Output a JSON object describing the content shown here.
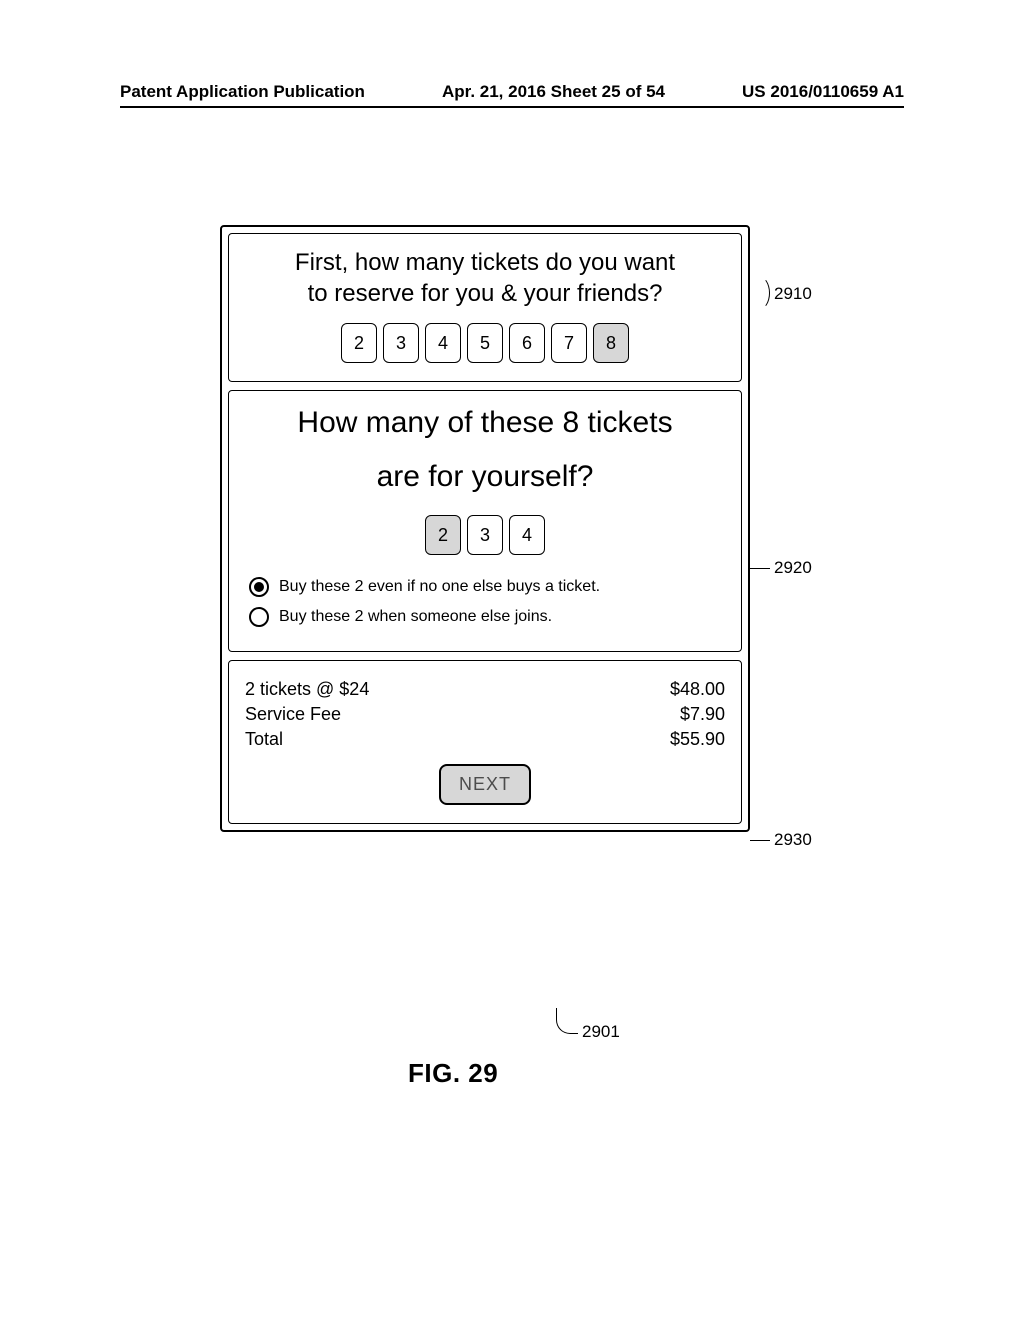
{
  "header": {
    "left": "Patent Application Publication",
    "middle": "Apr. 21, 2016  Sheet 25 of 54",
    "right": "US 2016/0110659 A1"
  },
  "panel1": {
    "line1": "First, how many tickets do you want",
    "line2": "to reserve for you & your friends?",
    "options": [
      "2",
      "3",
      "4",
      "5",
      "6",
      "7",
      "8"
    ],
    "selected": "8"
  },
  "panel2": {
    "line1": "How many of these 8 tickets",
    "line2": "are for yourself?",
    "options": [
      "2",
      "3",
      "4"
    ],
    "selected": "2",
    "radio1": "Buy these 2 even if no one else buys a ticket.",
    "radio2": "Buy these 2 when someone else joins."
  },
  "summary": {
    "row1_label": "2 tickets @ $24",
    "row1_value": "$48.00",
    "row2_label": "Service Fee",
    "row2_value": "$7.90",
    "row3_label": "Total",
    "row3_value": "$55.90",
    "next": "NEXT"
  },
  "callouts": {
    "c1": "2910",
    "c2": "2920",
    "c3": "2930",
    "c4": "2901"
  },
  "figure_title": "FIG. 29"
}
